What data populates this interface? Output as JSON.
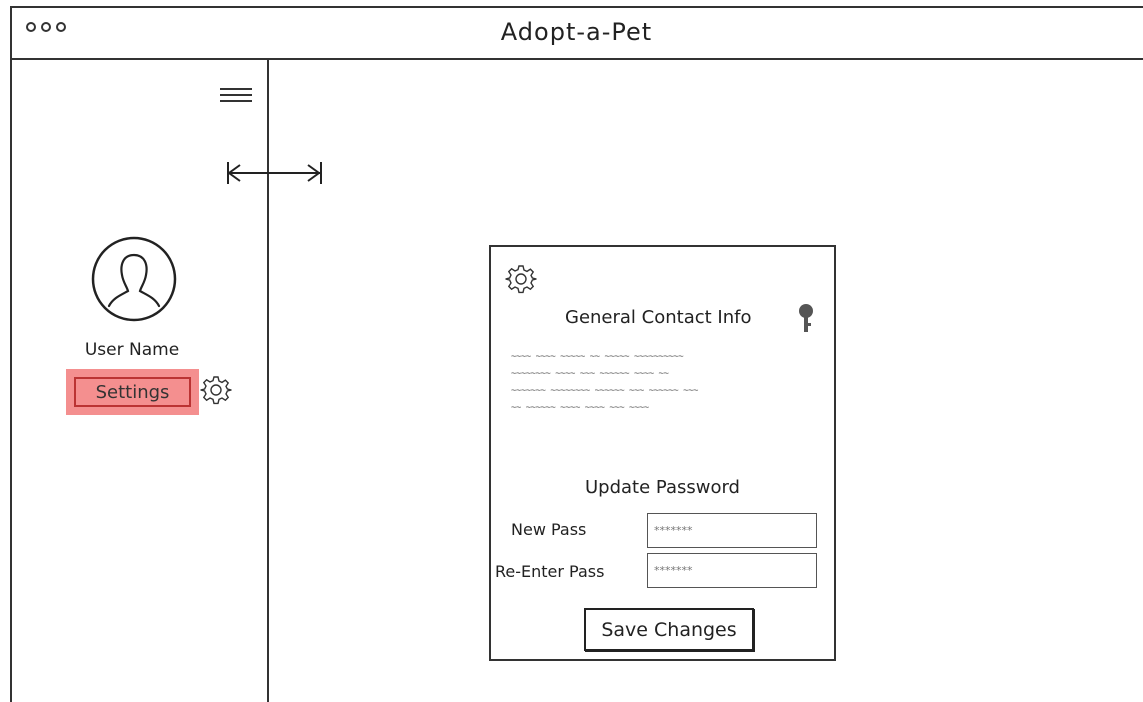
{
  "window": {
    "title": "Adopt-a-Pet"
  },
  "sidebar": {
    "user_name": "User Name",
    "settings_label": "Settings"
  },
  "card": {
    "contact_title": "General Contact Info",
    "contact_placeholder_lines": [
      "~~~~ ~~~~ ~~~~~ ~~ ~~~~~  ~~~~~~~~~~",
      "~~~~~~~~ ~~~~ ~~~ ~~~~~~ ~~~~ ~~",
      "~~~~~~~ ~~~~~~~~ ~~~~~~ ~~~ ~~~~~~ ~~~",
      "~~ ~~~~~~ ~~~~ ~~~~ ~~~ ~~~~"
    ],
    "password_title": "Update Password",
    "new_pass_label": "New Pass",
    "new_pass_placeholder": "*******",
    "reenter_pass_label": "Re-Enter Pass",
    "reenter_pass_placeholder": "*******",
    "save_label": "Save Changes"
  },
  "colors": {
    "settings_highlight": "#f48f8f",
    "settings_border": "#bb3333"
  },
  "icons": {
    "window_controls": "three-circles",
    "menu": "hamburger-icon",
    "resize": "double-arrow-icon",
    "avatar": "user-silhouette-icon",
    "settings": "gear-icon",
    "secure": "key-icon"
  }
}
